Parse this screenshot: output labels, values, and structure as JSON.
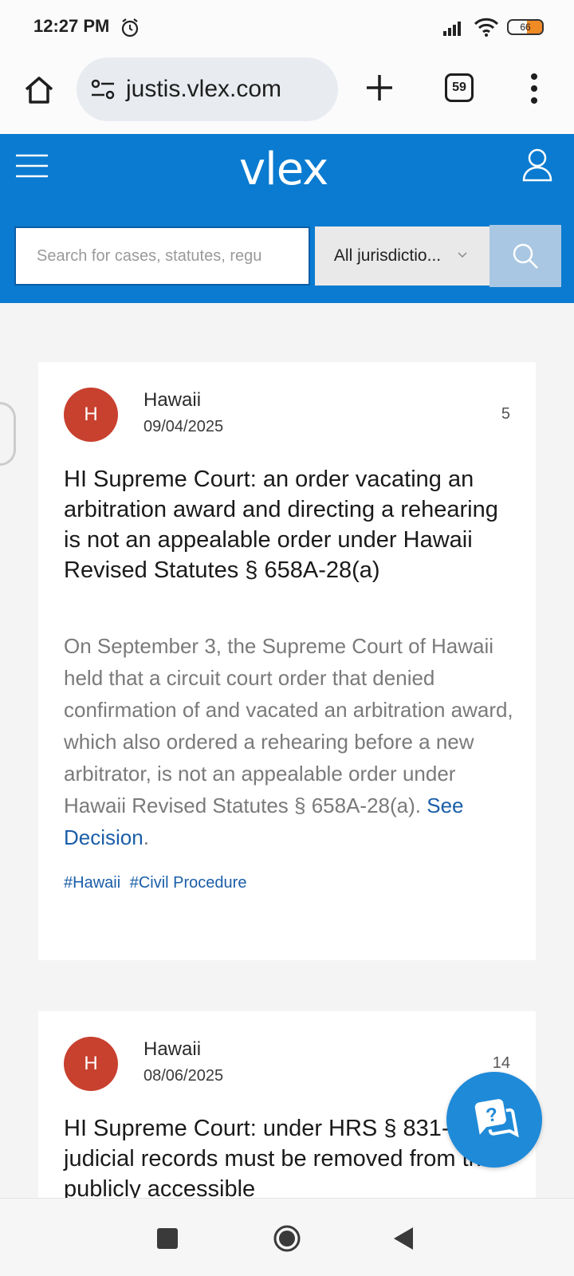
{
  "status_bar": {
    "time": "12:27 PM",
    "battery_level": "66",
    "icons": [
      "alarm-icon",
      "signal-icon",
      "wifi-icon",
      "battery-icon"
    ]
  },
  "browser": {
    "url": "justis.vlex.com",
    "tab_count": "59",
    "icons": [
      "home-icon",
      "site-settings-icon",
      "new-tab-icon",
      "tabs-icon",
      "more-menu-icon"
    ]
  },
  "header": {
    "logo": "vlex",
    "search_placeholder": "Search for cases, statutes, regu",
    "jurisdiction_selected": "All jurisdictio...",
    "brand_color": "#0a7bd1"
  },
  "cards": [
    {
      "avatar_letter": "H",
      "jurisdiction": "Hawaii",
      "date": "09/04/2025",
      "count": "5",
      "title": "HI Supreme Court: an order vacating an arbitration award and directing a rehearing is not an appealable order under Hawaii Revised Statutes § 658A-28(a)",
      "body": "On September 3, the Supreme Court of Hawaii held that a circuit court order that denied confirmation of and vacated an arbitration award, which also ordered a rehearing before a new arbitrator, is not an appealable order under Hawaii Revised Statutes § 658A-28(a). ",
      "link_text": "See Decision",
      "link_suffix": ".",
      "tags": [
        "#Hawaii",
        "#Civil Procedure"
      ]
    },
    {
      "avatar_letter": "H",
      "jurisdiction": "Hawaii",
      "date": "08/06/2025",
      "count": "14",
      "title": "HI Supreme Court: under HRS § 831-3.2(f), judicial records must be removed from the publicly accessible"
    }
  ],
  "avatar_color": "#c8402e"
}
